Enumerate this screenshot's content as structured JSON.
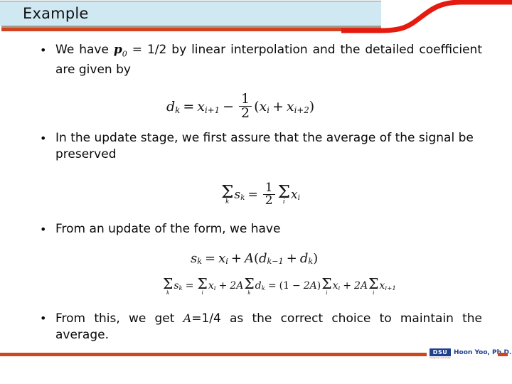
{
  "slide": {
    "title": "Example",
    "colors": {
      "header_band": "#cfe8f2",
      "accent_red": "#d1441f",
      "footer_rule": "#cc4720",
      "title_text": "#101010",
      "body_text": "#0a0a0a",
      "footer_name": "#1f3f8f"
    }
  },
  "bullets": [
    {
      "marker": "•",
      "text_before_math": "We have ",
      "math_var": "p",
      "math_sub": "0",
      "text_after_math": " = 1/2 by linear interpolation and the detailed coefficient are given by"
    },
    {
      "marker": "•",
      "text": "In the update stage, we first assure that the average of the signal be preserved"
    },
    {
      "marker": "•",
      "text": "From an update of the form, we have"
    },
    {
      "marker": "•",
      "text_before_math": "From this, we get ",
      "math_var": "A",
      "text_after_math": "=1/4 as the correct choice to maintain the average."
    }
  ],
  "equations": {
    "eq1": {
      "lhs_var": "d",
      "lhs_sub": "k",
      "equals": "=",
      "term1_var": "x",
      "term1_sub": "i+1",
      "minus": "−",
      "frac_num": "1",
      "frac_den": "2",
      "paren_open": "(",
      "term2_var": "x",
      "term2_sub": "i",
      "plus": "+",
      "term3_var": "x",
      "term3_sub": "i+2",
      "paren_close": ")",
      "plain": "d_k = x_{i+1} - (1/2)(x_i + x_{i+2})"
    },
    "eq2": {
      "sigma": "Σ",
      "sum1_idx": "k",
      "sum1_var": "s",
      "sum1_var_sub": "k",
      "equals": "=",
      "frac_num": "1",
      "frac_den": "2",
      "sum2_idx": "i",
      "sum2_var": "x",
      "sum2_var_sub": "i",
      "plain": "Σ_k s_k = (1/2) Σ_i x_i"
    },
    "eq3": {
      "lhs_var": "s",
      "lhs_sub": "k",
      "equals": "=",
      "term1_var": "x",
      "term1_sub": "i",
      "plus": "+",
      "coef": "A",
      "paren_open": "(",
      "term2_var": "d",
      "term2_sub": "k−1",
      "plus2": "+",
      "term3_var": "d",
      "term3_sub": "k",
      "paren_close": ")",
      "plain": "s_k = x_i + A(d_{k-1} + d_k)"
    },
    "eq4": {
      "sigma": "Σ",
      "s1_idx": "k",
      "s1_var": "s",
      "s1_sub": "k",
      "equals1": "=",
      "s2_idx": "i",
      "s2_var": "x",
      "s2_sub": "i",
      "plus1": "+",
      "coef1": "2A",
      "s3_idx": "k",
      "s3_var": "d",
      "s3_sub": "k",
      "equals2": "=",
      "paren_open": "(",
      "one": "1",
      "minus": "−",
      "coef2": "2A",
      "paren_close": ")",
      "s4_idx": "i",
      "s4_var": "x",
      "s4_sub": "i",
      "plus2": "+",
      "coef3": "2A",
      "s5_idx": "i",
      "s5_var": "x",
      "s5_sub": "i+1",
      "plain": "Σ_k s_k = Σ_i x_i + 2A Σ_k d_k = (1−2A) Σ_i x_i + 2A Σ_i x_{i+1}"
    }
  },
  "footer": {
    "logo_text": "DSU",
    "logo_subtext": "Dongseo University",
    "name": "Hoon Yoo, Ph.D."
  }
}
